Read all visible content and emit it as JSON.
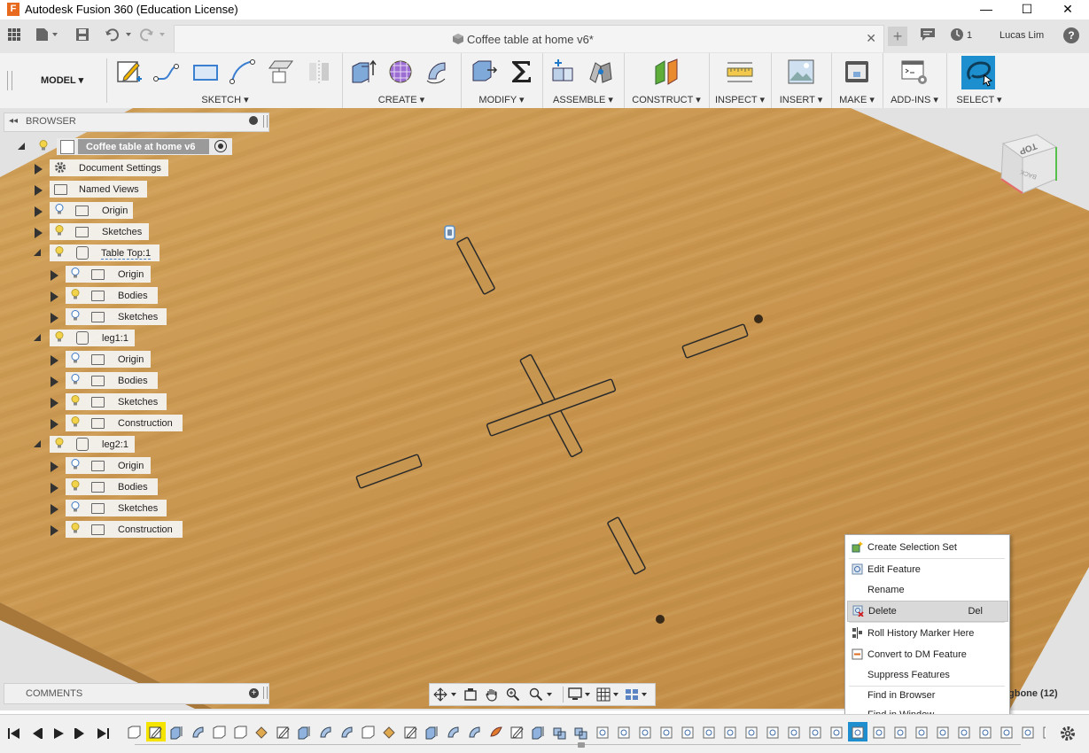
{
  "window": {
    "title": "Autodesk Fusion 360 (Education License)",
    "minimize": "—",
    "maximize": "☐",
    "close": "✕"
  },
  "qat": {
    "document_tab": "Coffee table at home v6*",
    "job_count": "1",
    "user": "Lucas Lim",
    "help": "?"
  },
  "ribbon": {
    "workspace": "MODEL ▾",
    "groups": [
      {
        "label": "SKETCH ▾"
      },
      {
        "label": "CREATE ▾"
      },
      {
        "label": "MODIFY ▾"
      },
      {
        "label": "ASSEMBLE ▾"
      },
      {
        "label": "CONSTRUCT ▾"
      },
      {
        "label": "INSPECT ▾"
      },
      {
        "label": "INSERT ▾"
      },
      {
        "label": "MAKE ▾"
      },
      {
        "label": "ADD-INS ▾"
      },
      {
        "label": "SELECT ▾"
      }
    ]
  },
  "browser": {
    "title": "BROWSER",
    "root": "Coffee table at home v6",
    "items": [
      {
        "label": "Document Settings"
      },
      {
        "label": "Named Views"
      },
      {
        "label": "Origin"
      },
      {
        "label": "Sketches"
      },
      {
        "label": "Table Top:1"
      },
      {
        "label": "Origin"
      },
      {
        "label": "Bodies"
      },
      {
        "label": "Sketches"
      },
      {
        "label": "leg1:1"
      },
      {
        "label": "Origin"
      },
      {
        "label": "Bodies"
      },
      {
        "label": "Sketches"
      },
      {
        "label": "Construction"
      },
      {
        "label": "leg2:1"
      },
      {
        "label": "Origin"
      },
      {
        "label": "Bodies"
      },
      {
        "label": "Sketches"
      },
      {
        "label": "Construction"
      }
    ]
  },
  "viewcube": {
    "top": "TOP",
    "back": "BACK"
  },
  "comments": {
    "title": "COMMENTS"
  },
  "context_menu": {
    "items": [
      {
        "label": "Create Selection Set",
        "shortcut": ""
      },
      {
        "label": "Edit Feature",
        "shortcut": ""
      },
      {
        "label": "Rename",
        "shortcut": ""
      },
      {
        "label": "Delete",
        "shortcut": "Del"
      },
      {
        "label": "Roll History Marker Here",
        "shortcut": ""
      },
      {
        "label": "Convert to DM Feature",
        "shortcut": ""
      },
      {
        "label": "Suppress Features",
        "shortcut": ""
      },
      {
        "label": "Find in Browser",
        "shortcut": ""
      },
      {
        "label": "Find in Window",
        "shortcut": ""
      }
    ],
    "hint": "gbone (12)"
  },
  "colors": {
    "wood": "#c9974f",
    "wood_dark": "#b9843e",
    "select_blue": "#1d8fcf",
    "highlight_yellow": "#f5e400"
  }
}
